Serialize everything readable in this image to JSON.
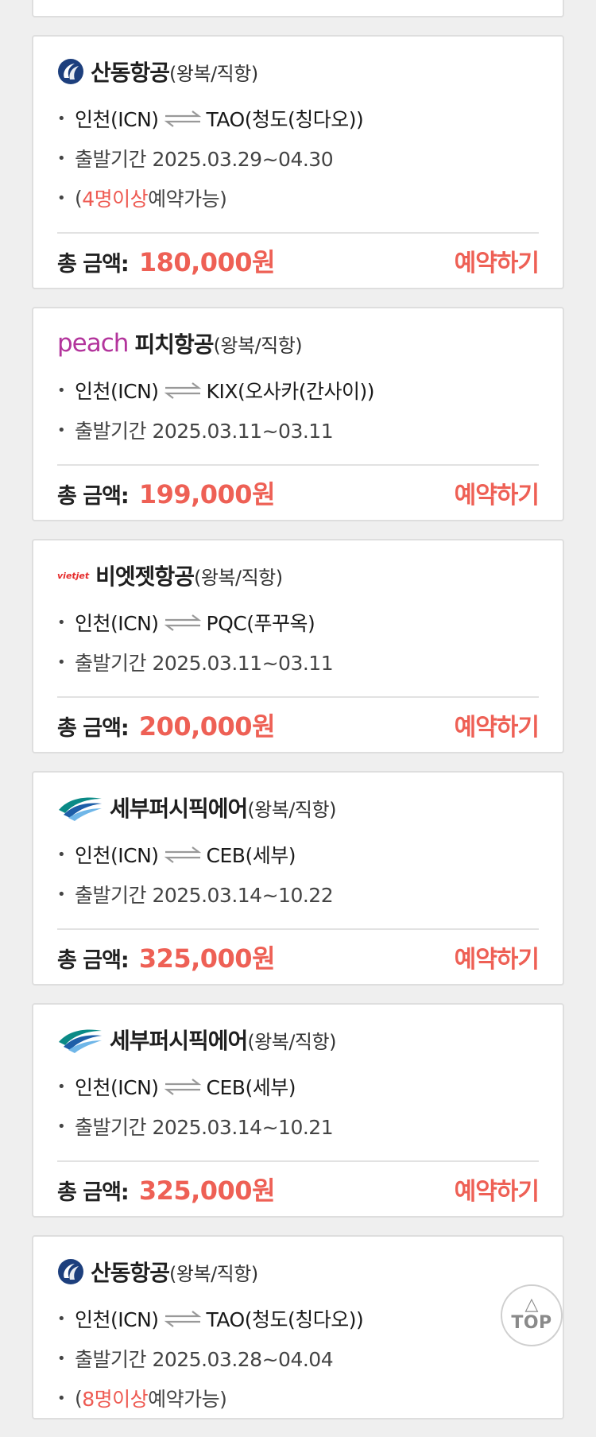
{
  "common": {
    "total_label": "총 금액:",
    "book_label": "예약하기",
    "trip_type": "(왕복/직항)",
    "from": "인천(ICN)"
  },
  "cards": [
    {
      "airline": "산동항공",
      "logo": "shandong-airlines-logo",
      "to": "TAO(청도(칭다오))",
      "period": "출발기간 2025.03.29~04.30",
      "note_pre": "(",
      "note_highlight": "4명이상",
      "note_post": " 예약가능)",
      "price": "180,000원"
    },
    {
      "airline": "피치항공",
      "logo": "peach-logo",
      "logo_text": "peach",
      "to": "KIX(오사카(간사이))",
      "period": "출발기간 2025.03.11~03.11",
      "price": "199,000원"
    },
    {
      "airline": "비엣젯항공",
      "logo": "vietjet-logo",
      "logo_text": "vietjet",
      "to": "PQC(푸꾸옥)",
      "period": "출발기간 2025.03.11~03.11",
      "price": "200,000원"
    },
    {
      "airline": "세부퍼시픽에어",
      "logo": "cebu-pacific-logo",
      "to": "CEB(세부)",
      "period": "출발기간 2025.03.14~10.22",
      "price": "325,000원"
    },
    {
      "airline": "세부퍼시픽에어",
      "logo": "cebu-pacific-logo",
      "to": "CEB(세부)",
      "period": "출발기간 2025.03.14~10.21",
      "price": "325,000원"
    },
    {
      "airline": "산동항공",
      "logo": "shandong-airlines-logo",
      "to": "TAO(청도(칭다오))",
      "period": "출발기간 2025.03.28~04.04",
      "note_pre": "(",
      "note_highlight": "8명이상",
      "note_post": " 예약가능)"
    }
  ],
  "top_button": {
    "arrow": "△",
    "label": "TOP"
  },
  "colors": {
    "accent": "#ee6055",
    "background": "#efefef",
    "card_border": "#dedede"
  }
}
